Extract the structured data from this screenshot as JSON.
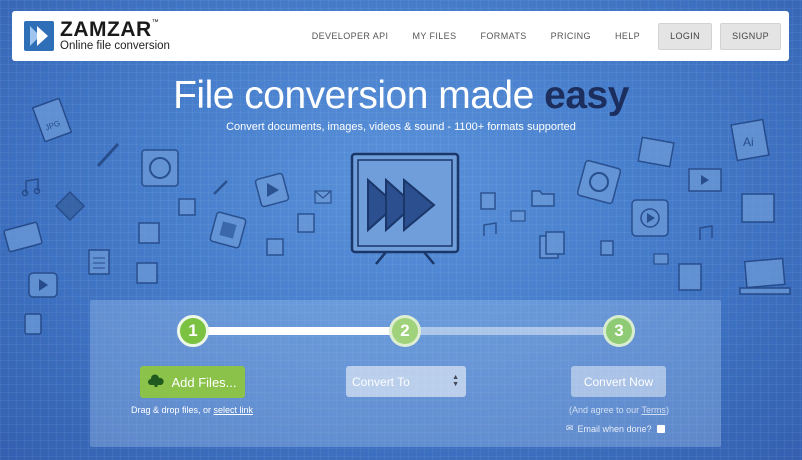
{
  "header": {
    "logo": {
      "name": "ZAMZAR",
      "trademark": "™",
      "tagline": "Online file conversion",
      "icon": "zamzar-logo-icon"
    },
    "nav": [
      "DEVELOPER API",
      "MY FILES",
      "FORMATS",
      "PRICING",
      "HELP"
    ],
    "login_label": "LOGIN",
    "signup_label": "SIGNUP"
  },
  "hero": {
    "title_prefix": "File conversion made ",
    "title_emphasis": "easy",
    "subtitle": "Convert documents, images, videos & sound - 1100+ formats supported"
  },
  "steps": {
    "step1": "1",
    "step2": "2",
    "step3": "3"
  },
  "add_files": {
    "label": "Add Files...",
    "icon": "upload-cloud-icon",
    "drag_text": "Drag & drop files, or ",
    "select_link": "select link"
  },
  "convert_to": {
    "selected": "Convert To"
  },
  "convert_now": {
    "label": "Convert Now",
    "agree_prefix": "(And agree to our ",
    "terms": "Terms",
    "agree_suffix": ")",
    "email_label": "Email when done?",
    "email_icon": "envelope-icon"
  },
  "colors": {
    "background": "#3d74c4",
    "easy": "#1b2e5e",
    "green": "#8bc34a"
  }
}
